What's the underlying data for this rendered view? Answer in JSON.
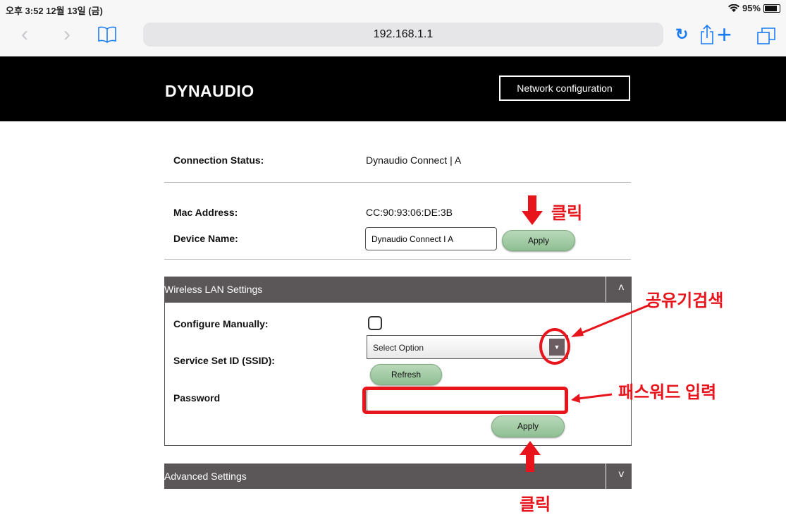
{
  "status_bar": {
    "time": "오후 3:52  12월 13일 (금)",
    "battery": "95%",
    "battery_level": 0.95,
    "icons": [
      "wifi-icon",
      "battery-icon"
    ]
  },
  "browser": {
    "url": "192.168.1.1",
    "icons": [
      "back-icon",
      "forward-icon",
      "bookmarks-icon",
      "reload-icon",
      "share-icon",
      "new-tab-icon",
      "tabs-icon"
    ],
    "accent_color": "#1a7cf5"
  },
  "header": {
    "logo": "DYNAUDIO",
    "nav_button": "Network configuration",
    "background": "#000000"
  },
  "connection": {
    "status_label": "Connection Status:",
    "status_value": "Dynaudio Connect | A",
    "mac_label": "Mac Address:",
    "mac_value": "CC:90:93:06:DE:3B",
    "device_label": "Device Name:",
    "device_value": "Dynaudio Connect I A",
    "apply_label": "Apply"
  },
  "wireless": {
    "title": "Wireless LAN Settings",
    "configure_label": "Configure Manually:",
    "ssid_label": "Service Set ID (SSID):",
    "ssid_select": "Select Option",
    "refresh_label": "Refresh",
    "password_label": "Password",
    "password_value": "",
    "apply_label": "Apply",
    "expanded": true
  },
  "advanced": {
    "title": "Advanced Settings",
    "expanded": false
  },
  "annotations": {
    "click_top": "클릭",
    "search_router": "공유기검색",
    "password_input": "패스워드 입력",
    "click_bottom": "클릭",
    "color": "#e8141c"
  }
}
